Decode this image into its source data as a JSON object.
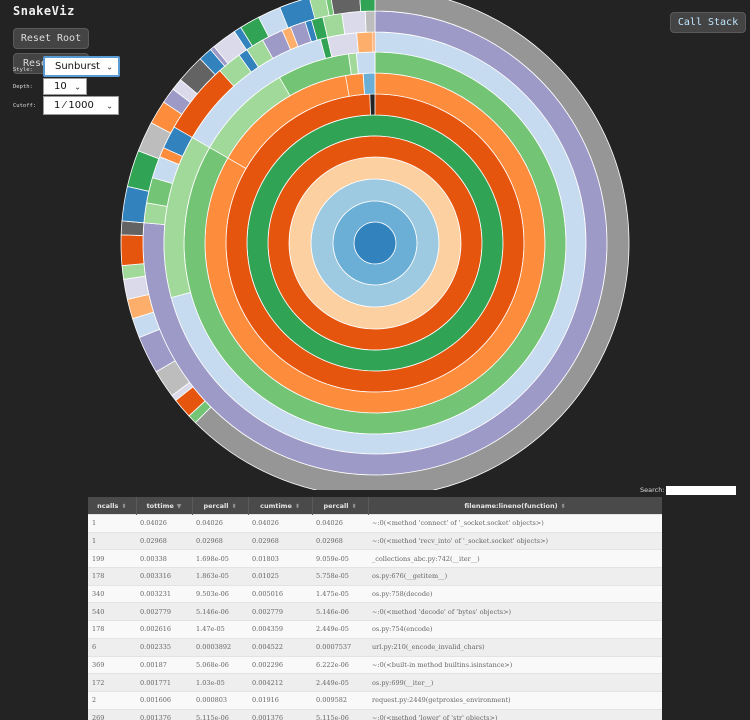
{
  "app": {
    "title": "SnakeViz"
  },
  "buttons": {
    "reset_root": "Reset Root",
    "reset_zoom": "Reset Zoom",
    "call_stack": "Call Stack"
  },
  "controls": {
    "style_label": "Style:",
    "style_value": "Sunburst",
    "depth_label": "Depth:",
    "depth_value": "10",
    "cutoff_label": "Cutoff:",
    "cutoff_value": "1 ⁄ 1000"
  },
  "search": {
    "label": "Search:"
  },
  "colors": {
    "background": "#232323",
    "table_header": "#4a4a4a",
    "accent": "#5b9bd5"
  },
  "table": {
    "columns": [
      "ncalls",
      "tottime",
      "percall",
      "cumtime",
      "percall",
      "filename:lineno(function)"
    ],
    "rows": [
      [
        "1",
        "0.04026",
        "0.04026",
        "0.04026",
        "0.04026",
        "~:0(<method 'connect' of '_socket.socket' objects>)"
      ],
      [
        "1",
        "0.02968",
        "0.02968",
        "0.02968",
        "0.02968",
        "~:0(<method 'recv_into' of '_socket.socket' objects>)"
      ],
      [
        "199",
        "0.00338",
        "1.698e-05",
        "0.01803",
        "9.059e-05",
        "_collections_abc.py:742(__iter__)"
      ],
      [
        "178",
        "0.003316",
        "1.863e-05",
        "0.01025",
        "5.758e-05",
        "os.py:676(__getitem__)"
      ],
      [
        "340",
        "0.003231",
        "9.503e-06",
        "0.005016",
        "1.475e-05",
        "os.py:758(decode)"
      ],
      [
        "540",
        "0.002779",
        "5.146e-06",
        "0.002779",
        "5.146e-06",
        "~:0(<method 'decode' of 'bytes' objects>)"
      ],
      [
        "178",
        "0.002616",
        "1.47e-05",
        "0.004359",
        "2.449e-05",
        "os.py:754(encode)"
      ],
      [
        "6",
        "0.002335",
        "0.0003892",
        "0.004522",
        "0.0007537",
        "url.py:210(_encode_invalid_chars)"
      ],
      [
        "369",
        "0.00187",
        "5.068e-06",
        "0.002296",
        "6.222e-06",
        "~:0(<built-in method builtins.isinstance>)"
      ],
      [
        "172",
        "0.001771",
        "1.03e-05",
        "0.004212",
        "2.449e-05",
        "os.py:699(__iter__)"
      ],
      [
        "2",
        "0.001606",
        "0.000803",
        "0.01916",
        "0.009582",
        "request.py:2449(getproxies_environment)"
      ],
      [
        "269",
        "0.001376",
        "5.115e-06",
        "0.001376",
        "5.115e-06",
        "~:0(<method 'lower' of 'str' objects>)"
      ],
      [
        "",
        "",
        "",
        "",
        "",
        ""
      ]
    ]
  }
}
